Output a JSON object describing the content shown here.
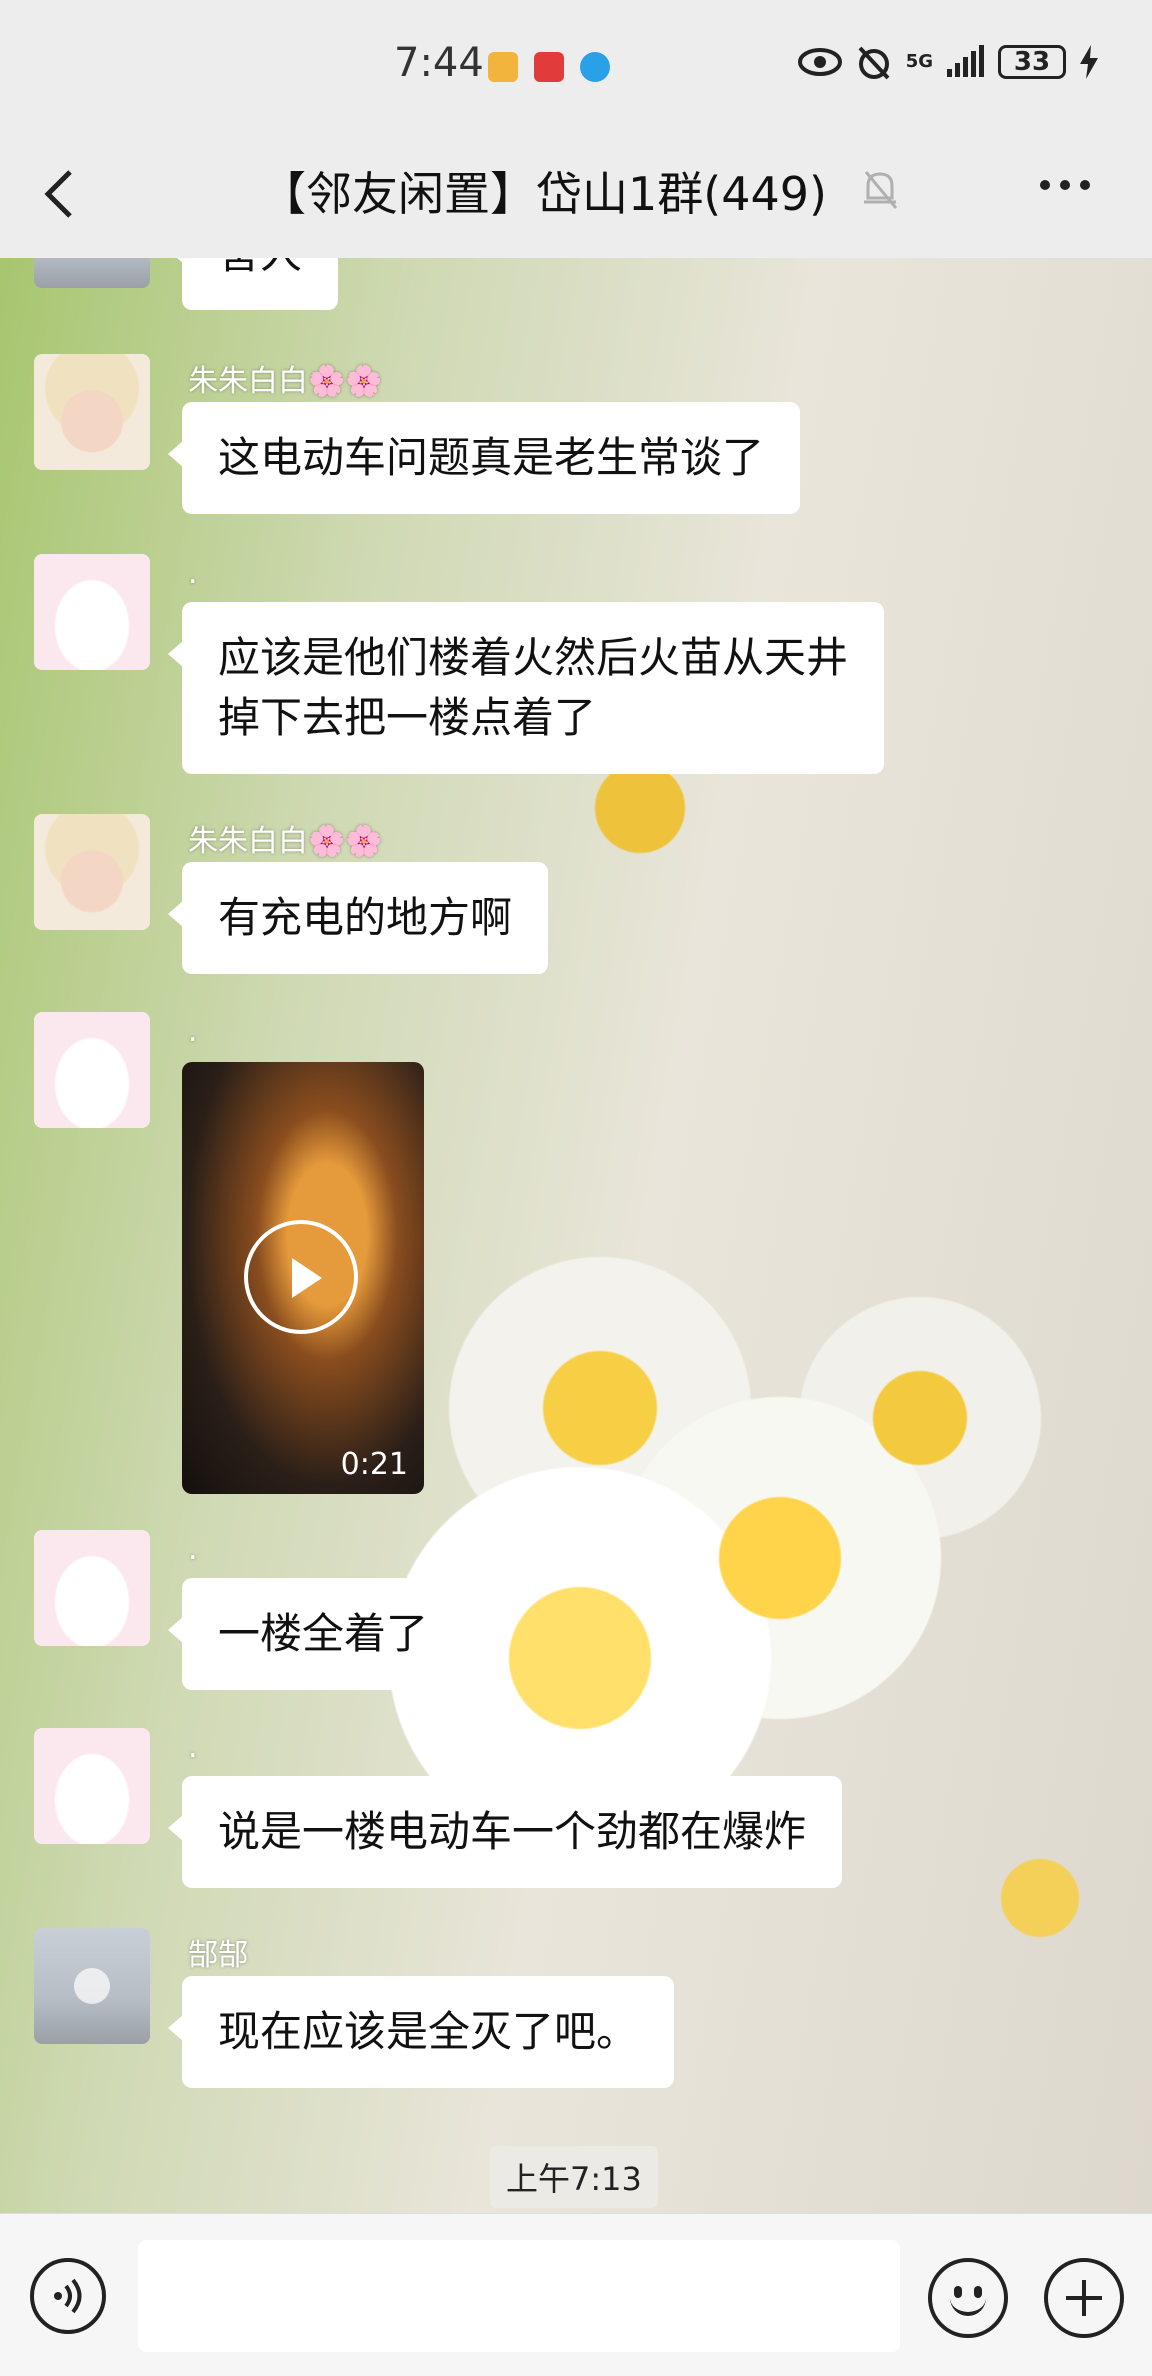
{
  "status_bar": {
    "time": "7:44",
    "network": "5G",
    "battery": "33",
    "app_icons": [
      "app-badge-icon",
      "app-red-icon",
      "app-blue-icon"
    ]
  },
  "header": {
    "title": "【邻友闲置】岱山1群(449)",
    "back_icon": "chevron-left-icon",
    "mute_icon": "bell-off-icon",
    "more_icon": "more-dots-icon"
  },
  "messages": [
    {
      "sender": "",
      "text": "害人",
      "avatar": "partial"
    },
    {
      "sender": "朱朱白白🌸🌸",
      "text": "这电动车问题真是老生常谈了",
      "avatar": "baby"
    },
    {
      "sender": ".",
      "text": "应该是他们楼着火然后火苗从天井\n掉下去把一楼点着了",
      "avatar": "bunny"
    },
    {
      "sender": "朱朱白白🌸🌸",
      "text": "有充电的地方啊",
      "avatar": "baby"
    },
    {
      "sender": ".",
      "video_duration": "0:21",
      "avatar": "bunny"
    },
    {
      "sender": ".",
      "text": "一楼全着了",
      "avatar": "bunny"
    },
    {
      "sender": ".",
      "text": "说是一楼电动车一个劲都在爆炸",
      "avatar": "bunny"
    },
    {
      "sender": "郜郜",
      "text": "现在应该是全灭了吧。",
      "avatar": "kid"
    }
  ],
  "timestamp": "上午7:13",
  "input_bar": {
    "placeholder": "",
    "voice_icon": "voice-icon",
    "emoji_icon": "emoji-icon",
    "plus_icon": "plus-icon"
  }
}
